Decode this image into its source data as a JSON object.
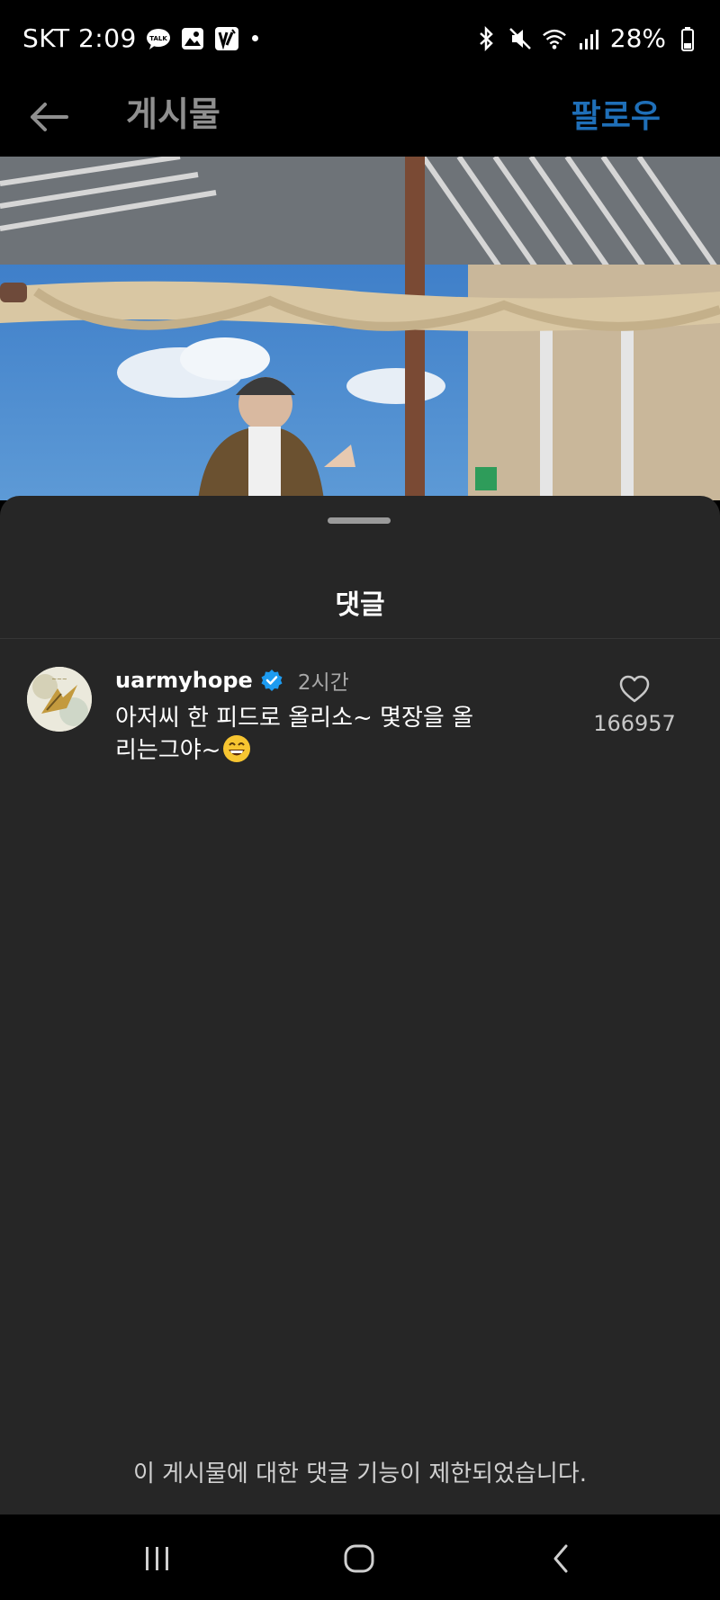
{
  "status_bar": {
    "carrier_time": "SKT 2:09",
    "battery": "28%",
    "icons": [
      "talk-icon",
      "gallery-icon",
      "app-icon",
      "notification-dot",
      "bluetooth-icon",
      "mute-icon",
      "wifi-icon",
      "signal-icon",
      "battery-icon"
    ]
  },
  "header": {
    "title": "게시물",
    "follow_label": "팔로우"
  },
  "comments_sheet": {
    "title": "댓글",
    "comments": [
      {
        "username": "uarmyhope",
        "verified": true,
        "time": "2시간",
        "text": "아저씨 한 피드로 올리소~ 몇장을 올리는그야~",
        "emoji": "grinning-face-with-smiling-eyes",
        "likes": "166957"
      }
    ],
    "restricted_notice": "이 게시물에 대한 댓글 기능이 제한되었습니다."
  },
  "nav_bar": {
    "icons": [
      "recent-apps-icon",
      "home-icon",
      "back-icon"
    ]
  },
  "colors": {
    "follow": "#1f6fb8",
    "sheet_bg": "#262626",
    "verified": "#1d9bf0"
  }
}
